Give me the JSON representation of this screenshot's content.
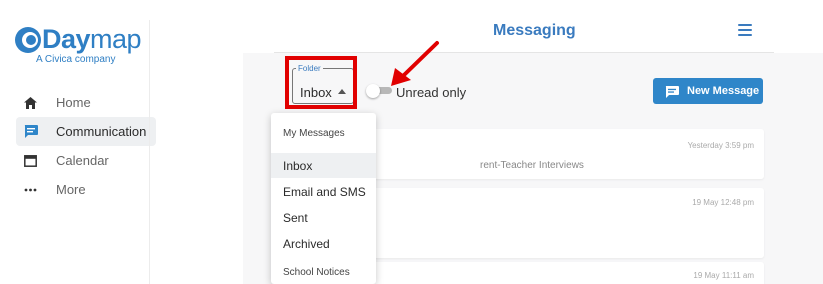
{
  "app": {
    "brand": "Daymap",
    "tagline": "A Civica company"
  },
  "sidebar": {
    "items": [
      {
        "label": "Home",
        "icon": "home-icon",
        "active": false
      },
      {
        "label": "Communication",
        "icon": "message-icon",
        "active": true
      },
      {
        "label": "Calendar",
        "icon": "calendar-icon",
        "active": false
      },
      {
        "label": "More",
        "icon": "more-dots-icon",
        "active": false
      }
    ]
  },
  "header": {
    "title": "Messaging",
    "menu_icon": "hamburger-menu-icon"
  },
  "toolbar": {
    "folder_legend": "Folder",
    "folder_value": "Inbox",
    "unread_label": "Unread only",
    "unread_checked": false,
    "new_message_label": "New Message"
  },
  "messages": [
    {
      "date": "Yesterday 3:59 pm",
      "subject": "rent-Teacher Interviews"
    },
    {
      "date": "19 May 12:48 pm",
      "subject": ""
    },
    {
      "date": "19 May 11:11 am",
      "subject": ""
    }
  ],
  "folder_menu": {
    "header": "My Messages",
    "items": [
      "Inbox",
      "Email and SMS",
      "Sent",
      "Archived"
    ],
    "selected": "Inbox",
    "section2_header": "School Notices"
  },
  "colors": {
    "brand": "#2f7fc4",
    "accent": "#2f86c9",
    "annotation": "#e10000"
  }
}
